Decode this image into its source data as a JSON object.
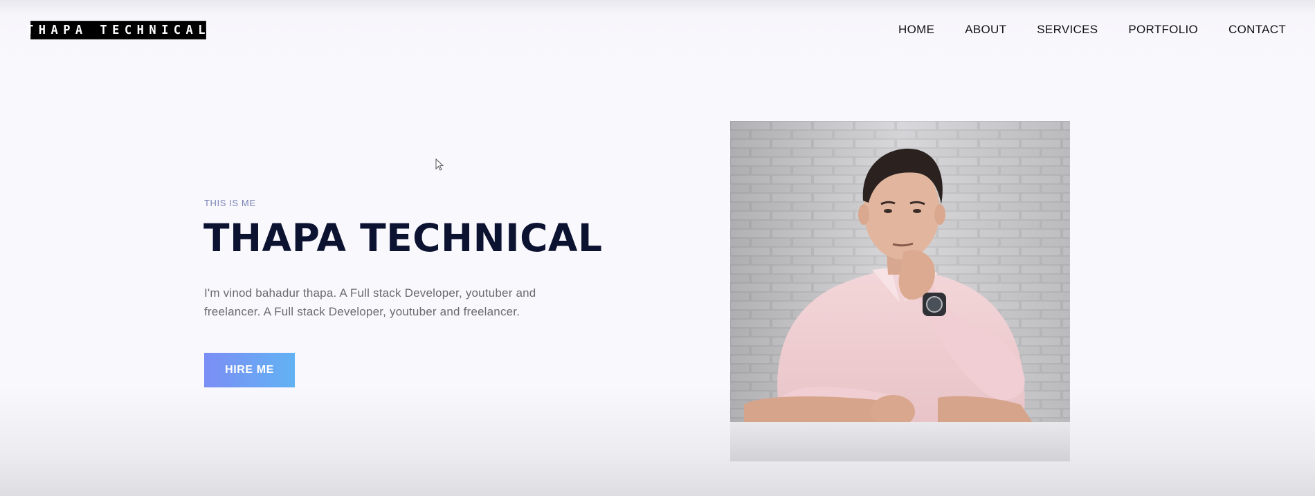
{
  "header": {
    "logo_text": "THAPA TECHNICAL",
    "nav": [
      "HOME",
      "ABOUT",
      "SERVICES",
      "PORTFOLIO",
      "CONTACT"
    ]
  },
  "hero": {
    "eyebrow": "THIS IS ME",
    "title": "THAPA TECHNICAL",
    "description": "I'm vinod bahadur thapa. A Full stack Developer, youtuber and freelancer. A Full stack Developer, youtuber and freelancer.",
    "cta_label": "HIRE ME",
    "photo": "portrait-photo"
  },
  "colors": {
    "title": "#0c1331",
    "eyebrow": "#7b83b6",
    "button_gradient_start": "#7b8ef5",
    "button_gradient_end": "#62b2f3"
  }
}
